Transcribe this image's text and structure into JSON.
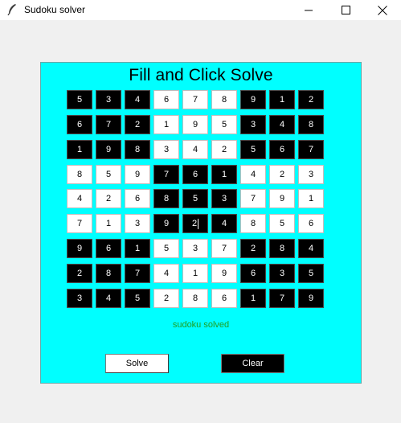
{
  "window": {
    "title": "Sudoku solver"
  },
  "heading": "Fill and Click Solve",
  "grid": {
    "rows": [
      [
        "5",
        "3",
        "4",
        "6",
        "7",
        "8",
        "9",
        "1",
        "2"
      ],
      [
        "6",
        "7",
        "2",
        "1",
        "9",
        "5",
        "3",
        "4",
        "8"
      ],
      [
        "1",
        "9",
        "8",
        "3",
        "4",
        "2",
        "5",
        "6",
        "7"
      ],
      [
        "8",
        "5",
        "9",
        "7",
        "6",
        "1",
        "4",
        "2",
        "3"
      ],
      [
        "4",
        "2",
        "6",
        "8",
        "5",
        "3",
        "7",
        "9",
        "1"
      ],
      [
        "7",
        "1",
        "3",
        "9",
        "2",
        "4",
        "8",
        "5",
        "6"
      ],
      [
        "9",
        "6",
        "1",
        "5",
        "3",
        "7",
        "2",
        "8",
        "4"
      ],
      [
        "2",
        "8",
        "7",
        "4",
        "1",
        "9",
        "6",
        "3",
        "5"
      ],
      [
        "3",
        "4",
        "5",
        "2",
        "8",
        "6",
        "1",
        "7",
        "9"
      ]
    ],
    "focused_cell": {
      "row": 5,
      "col": 4
    }
  },
  "status": "sudoku solved",
  "buttons": {
    "solve": "Solve",
    "clear": "Clear"
  },
  "colors": {
    "panel_bg": "#00ffff",
    "dark_cell": "#000000",
    "light_cell": "#ffffff",
    "status_text": "#1f9e1f"
  }
}
